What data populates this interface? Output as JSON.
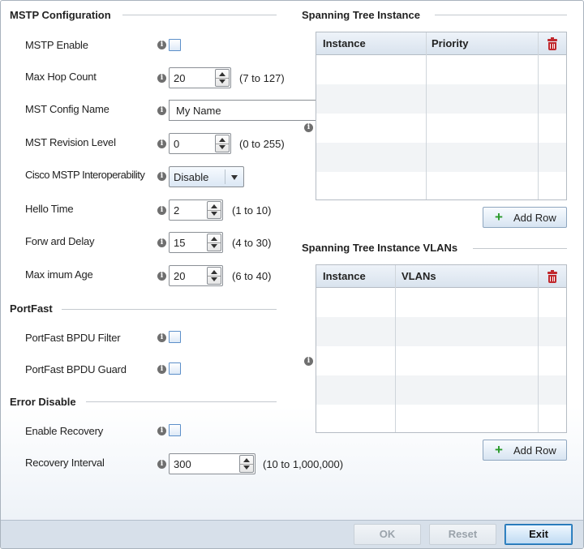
{
  "mstp": {
    "title": "MSTP Configuration",
    "enable_label": "MSTP Enable",
    "max_hop_label": "Max Hop Count",
    "max_hop_value": "20",
    "max_hop_range": "(7 to 127)",
    "config_name_label": "MST Config Name",
    "config_name_value": "My Name",
    "revision_label": "MST Revision Level",
    "revision_value": "0",
    "revision_range": "(0 to 255)",
    "cisco_label": "Cisco MSTP Interoperability",
    "cisco_value": "Disable",
    "hello_label": "Hello Time",
    "hello_value": "2",
    "hello_range": "(1 to 10)",
    "fwd_label": "Forw ard Delay",
    "fwd_value": "15",
    "fwd_range": "(4 to 30)",
    "maxage_label": "Max imum Age",
    "maxage_value": "20",
    "maxage_range": "(6 to 40)"
  },
  "portfast": {
    "title": "PortFast",
    "bpdu_filter_label": "PortFast BPDU Filter",
    "bpdu_guard_label": "PortFast BPDU Guard"
  },
  "error_disable": {
    "title": "Error Disable",
    "enable_recovery_label": "Enable Recovery",
    "interval_label": "Recovery Interval",
    "interval_value": "300",
    "interval_range": "(10 to 1,000,000)"
  },
  "sti": {
    "title": "Spanning Tree Instance",
    "col_instance": "Instance",
    "col_priority": "Priority",
    "add_row": "Add Row"
  },
  "sti_vlans": {
    "title": "Spanning Tree Instance VLANs",
    "col_instance": "Instance",
    "col_vlans": "VLANs",
    "add_row": "Add Row"
  },
  "footer": {
    "ok": "OK",
    "reset": "Reset",
    "exit": "Exit"
  }
}
